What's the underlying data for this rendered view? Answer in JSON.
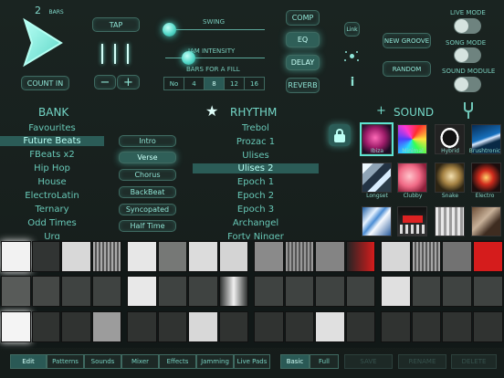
{
  "top": {
    "bars_count": "2",
    "bars_label": "BARS",
    "tap_label": "TAP",
    "count_in_label": "COUNT IN",
    "minus_label": "−",
    "plus_label": "+",
    "swing_label": "SWING",
    "jam_intensity_label": "JAM INTENSITY",
    "bars_for_fill_label": "BARS FOR A FILL",
    "fill_options": [
      "No",
      "4",
      "8",
      "12",
      "16"
    ],
    "fill_selected": "8",
    "comp_label": "COMP",
    "eq_label": "EQ",
    "delay_label": "DELAY",
    "reverb_label": "REVERB",
    "link_label": "Link",
    "info_label": "i",
    "new_groove_label": "NEW GROOVE",
    "random_label": "RANDOM",
    "live_mode_label": "LIVE MODE",
    "song_mode_label": "SONG MODE",
    "sound_module_label": "SOUND MODULE"
  },
  "headers": {
    "bank": "BANK",
    "rhythm": "RHYTHM",
    "plus": "+",
    "sound": "SOUND"
  },
  "bank_items": [
    "Favourites",
    "Future Beats",
    "FBeats x2",
    "Hip Hop",
    "House",
    "ElectroLatin",
    "Ternary",
    "Odd Times",
    "Urg"
  ],
  "bank_selected": "Future Beats",
  "sections": [
    "Intro",
    "Verse",
    "Chorus",
    "BackBeat",
    "Syncopated",
    "Half Time"
  ],
  "section_selected": "Verse",
  "rhythm_items": [
    "Trebol",
    "Prozac 1",
    "Ulises",
    "Ulises 2",
    "Epoch 1",
    "Epoch 2",
    "Epoch 3",
    "Archangel",
    "Forty Ninger"
  ],
  "rhythm_selected": "Ulises 2",
  "sound_tiles": [
    {
      "label": "Ibiza",
      "selected": true
    },
    {
      "label": "Minimal",
      "selected": false
    },
    {
      "label": "Hybrid",
      "selected": false
    },
    {
      "label": "Brushtronic",
      "selected": false
    },
    {
      "label": "Longset",
      "selected": false
    },
    {
      "label": "Clubby",
      "selected": false
    },
    {
      "label": "Snake",
      "selected": false
    },
    {
      "label": "Electro",
      "selected": false
    },
    {
      "label": "",
      "selected": false
    },
    {
      "label": "",
      "selected": false
    },
    {
      "label": "",
      "selected": false
    },
    {
      "label": "",
      "selected": false
    }
  ],
  "bottom_tabs": [
    "Edit",
    "Patterns",
    "Sounds",
    "Mixer",
    "Effects",
    "Jamming",
    "Live Pads"
  ],
  "bottom_tab_selected": "Edit",
  "view_tabs": [
    "Basic",
    "Full"
  ],
  "view_selected": "Basic",
  "actions": [
    "SAVE",
    "RENAME",
    "DELETE"
  ],
  "colors": {
    "accent": "#67e1d1",
    "background": "#18211f",
    "selected": "#2b5c57",
    "red": "#d51c1c"
  }
}
